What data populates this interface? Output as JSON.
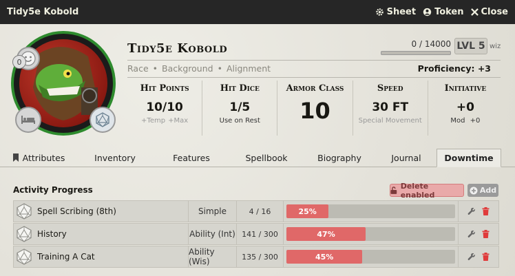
{
  "window": {
    "title": "Tidy5e Kobold",
    "buttons": {
      "sheet": "Sheet",
      "token": "Token",
      "close": "Close"
    }
  },
  "character": {
    "name": "Tidy5e Kobold",
    "exhaustion": "0",
    "xp": "0 / 14000",
    "xp_fraction": 0,
    "level": "LVL 5",
    "class_abbr": "wiz",
    "race": "Race",
    "background": "Background",
    "alignment": "Alignment",
    "separator": "•",
    "proficiency": "Proficiency: +3"
  },
  "stats": {
    "hp": {
      "label": "Hit Points",
      "value": "10/10",
      "temp": "+Temp",
      "max": "+Max"
    },
    "hd": {
      "label": "Hit Dice",
      "value": "1/5",
      "note": "Use on Rest"
    },
    "ac": {
      "label": "Armor Class",
      "value": "10"
    },
    "speed": {
      "label": "Speed",
      "value": "30 FT",
      "note": "Special Movement"
    },
    "init": {
      "label": "Initiative",
      "value": "+0",
      "mod_label": "Mod",
      "mod_value": "+0"
    }
  },
  "tabs": [
    "Attributes",
    "Inventory",
    "Features",
    "Spellbook",
    "Biography",
    "Journal",
    "Downtime"
  ],
  "active_tab": "Downtime",
  "activity": {
    "title": "Activity Progress",
    "delete_label": "Delete enabled",
    "add_label": "Add",
    "rows": [
      {
        "name": "Spell Scribing (8th)",
        "type": "Simple",
        "progress": "4 / 16",
        "percent": 25,
        "percent_label": "25%"
      },
      {
        "name": "History",
        "type": "Ability (Int)",
        "progress": "141 / 300",
        "percent": 47,
        "percent_label": "47%"
      },
      {
        "name": "Training A Cat",
        "type": "Ability (Wis)",
        "progress": "135 / 300",
        "percent": 45,
        "percent_label": "45%"
      }
    ]
  },
  "colors": {
    "accent_red": "#e06868",
    "portrait_ring": "#2e8b2e",
    "titlebar": "#262626"
  }
}
